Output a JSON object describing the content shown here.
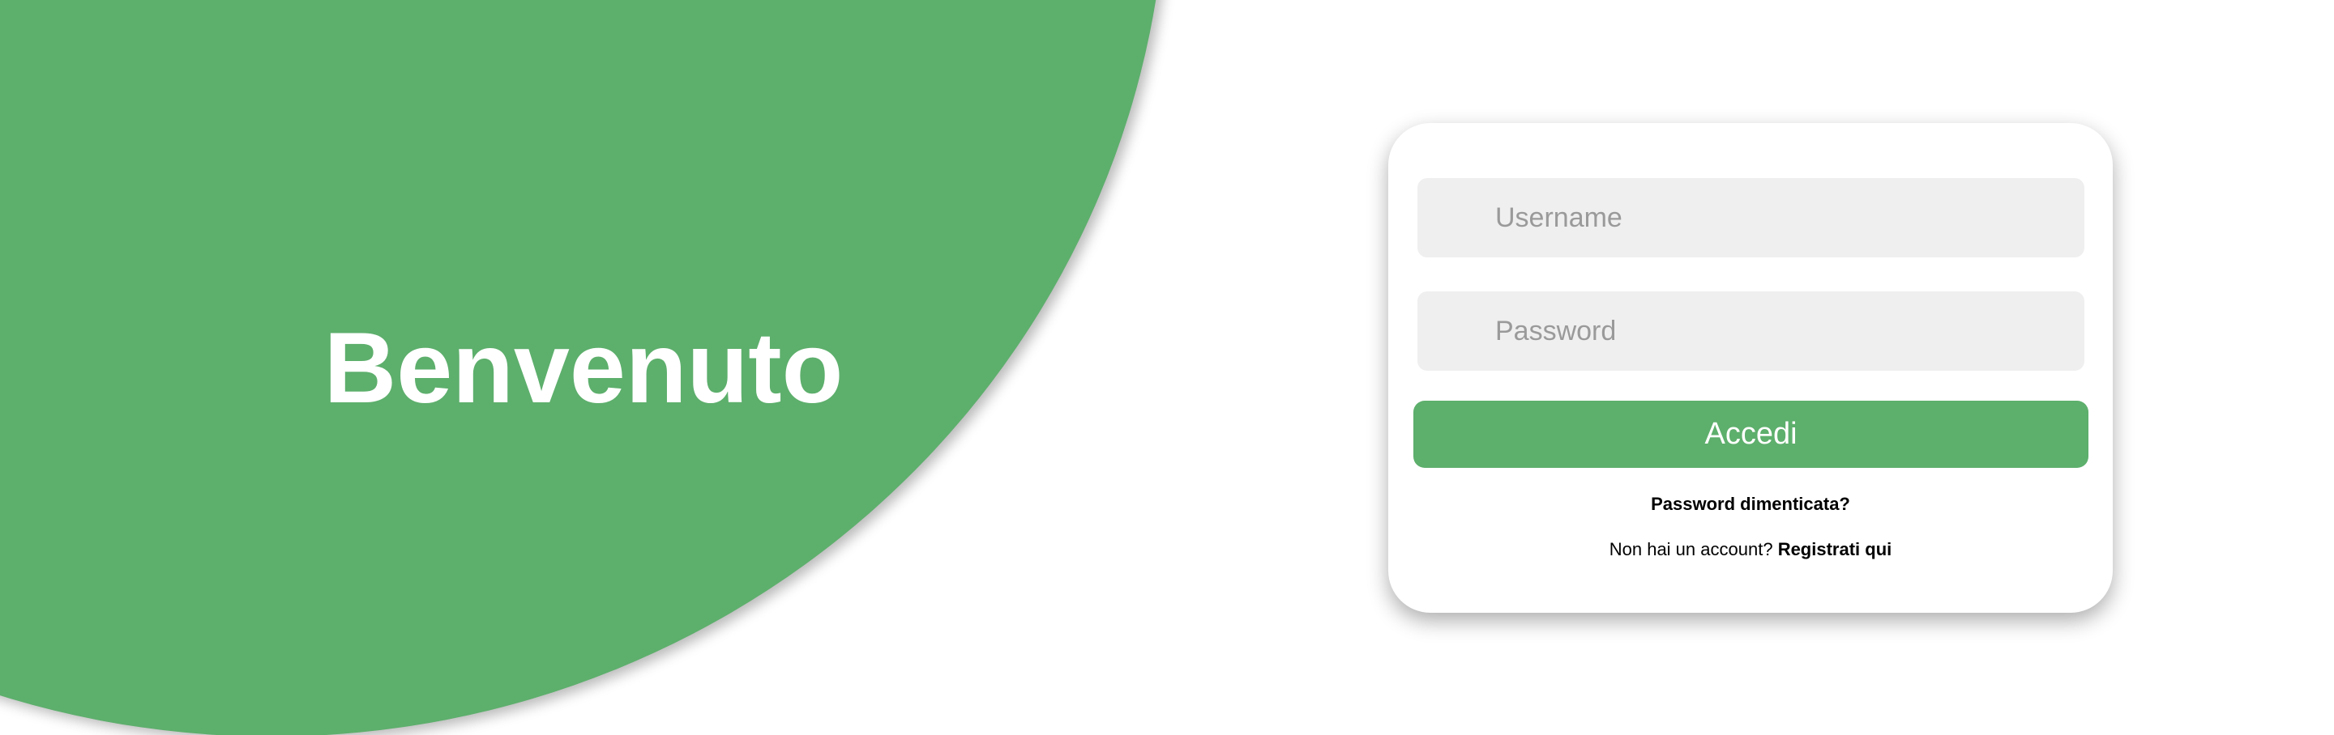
{
  "hero": {
    "title": "Benvenuto",
    "accent_color": "#5daf6c"
  },
  "login_form": {
    "username": {
      "placeholder": "Username",
      "value": "",
      "icon": "user-icon"
    },
    "password": {
      "placeholder": "Password",
      "value": "",
      "icon": "lock-icon"
    },
    "submit_label": "Accedi",
    "forgot_password_label": "Password dimenticata?",
    "register_prompt": "Non hai un account?",
    "register_link_label": "Registrati qui"
  }
}
